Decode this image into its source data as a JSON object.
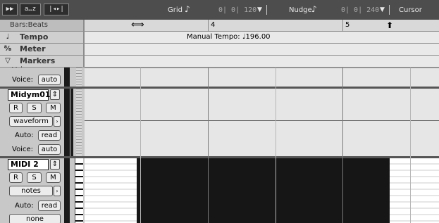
{
  "toolbar": {
    "sort_icon": "play-right-icon",
    "sort_label": "a…z",
    "grid_label": "Grid",
    "grid_value": "0| 0| 120",
    "nudge_label": "Nudge",
    "nudge_value": "0| 0| 240",
    "cursor_label": "Cursor",
    "note_glyph": "♪",
    "dropdown_glyph": "▼"
  },
  "rulers": {
    "main_ruler_label": "Bars:Beats",
    "tempo_label": "Tempo",
    "meter_label": "Meter",
    "markers_label": "Markers",
    "tempo_event": "Manual Tempo: ♩196.00",
    "bar_numbers": [
      "4",
      "5"
    ],
    "cursor_icon": "resize-cursor-icon",
    "playhead_icon": "up-arrow-icon"
  },
  "tracks": [
    {
      "name": "",
      "partial_label": "Voice:",
      "voice_label": "Voice:",
      "voice_value": "auto"
    },
    {
      "name": "Midym01",
      "rec_label": "R",
      "solo_label": "S",
      "mute_label": "M",
      "view_label": "waveform",
      "auto_label": "Auto:",
      "auto_value": "read",
      "voice_label": "Voice:",
      "voice_value": "auto"
    },
    {
      "name": "MIDI 2",
      "rec_label": "R",
      "solo_label": "S",
      "mute_label": "M",
      "view_label": "notes",
      "auto_label": "Auto:",
      "auto_value": "read",
      "channel_value": "none"
    }
  ],
  "colors": {
    "toolbar_bg": "#4d4d4d",
    "ruler_bg": "#e9e9e9",
    "lane_bg": "#e6e6e6",
    "midi_region": "#161616"
  }
}
